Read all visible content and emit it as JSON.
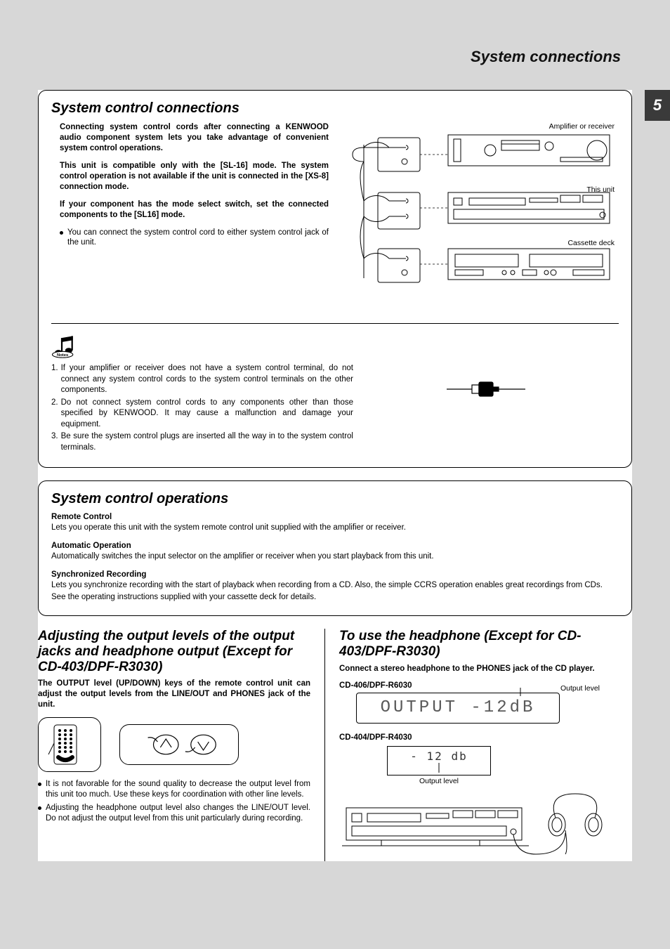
{
  "header": {
    "section": "System connections",
    "page_number": "5"
  },
  "box1": {
    "title": "System control connections",
    "p1": "Connecting system control cords after connecting a KENWOOD audio component system lets you take advantage of convenient system control operations.",
    "p2": "This unit is compatible only with the [SL-16] mode. The system control operation is not available if the unit is connected in the [XS-8] connection mode.",
    "p3": "If your component has the mode select switch, set the connected components to the [SL16] mode.",
    "bullet1": "You can connect the system control cord to either system control jack of the unit.",
    "diagram_labels": {
      "amp": "Amplifier or receiver",
      "unit": "This unit",
      "deck": "Cassette deck"
    },
    "notes_label": "Notes",
    "notes": {
      "n1": "If your amplifier or receiver does not have a system control terminal, do not connect any system control cords to the system control terminals on the other components.",
      "n2": "Do not connect system control cords to any components other than those specified by KENWOOD. It may cause a malfunction and damage your equipment.",
      "n3": "Be sure the system control plugs are inserted all the way in to the system control terminals."
    }
  },
  "box2": {
    "title": "System control operations",
    "remote_h": "Remote Control",
    "remote_b": "Lets you operate this unit with the system remote control unit supplied with the amplifier or receiver.",
    "auto_h": "Automatic Operation",
    "auto_b": "Automatically switches the input selector on the amplifier or receiver when you start playback from this unit.",
    "sync_h": "Synchronized Recording",
    "sync_b1": "Lets you synchronize recording with the start of playback when recording from a CD. Also, the simple CCRS operation enables great recordings from CDs.",
    "sync_b2": "See the operating instructions supplied with your cassette deck for details."
  },
  "left": {
    "title": "Adjusting the output levels of the output jacks and headphone output (Except for CD-403/DPF-R3030)",
    "lead": "The OUTPUT level (UP/DOWN) keys of the remote control unit can adjust the output levels from the LINE/OUT and PHONES jack of the unit.",
    "b1": "It is not favorable for the sound quality to decrease the output level from this unit too much. Use these keys for coordination with other line levels.",
    "b2": "Adjusting the headphone output level also changes the LINE/OUT level. Do not adjust the output level from this unit particularly during recording."
  },
  "right": {
    "title": "To use the headphone (Except for CD-403/DPF-R3030)",
    "lead": "Connect a stereo headphone to the PHONES jack of the CD player.",
    "model1": "CD-406/DPF-R6030",
    "model2": "CD-404/DPF-R4030",
    "output_level_label": "Output level",
    "lcd1": "OUTPUT  -12dB",
    "lcd2": "- 12 db"
  }
}
